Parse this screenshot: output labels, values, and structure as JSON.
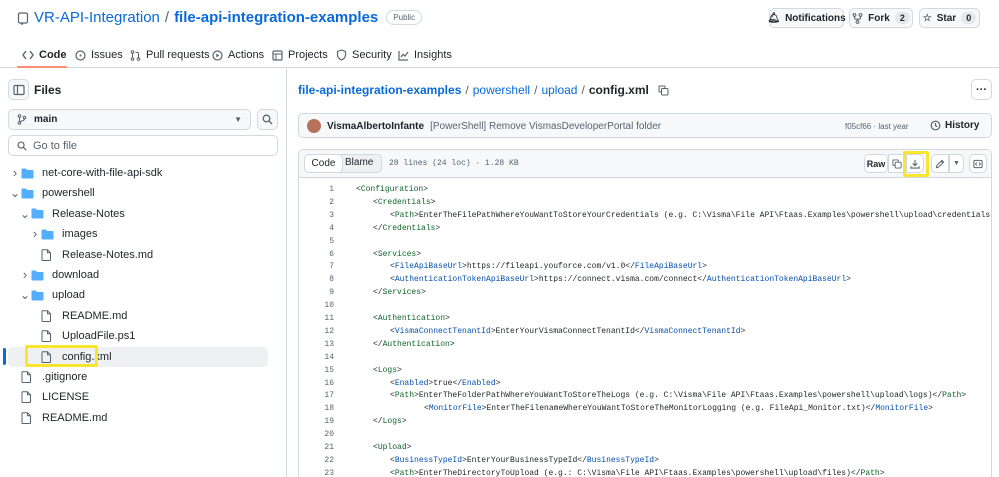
{
  "repo": {
    "owner": "VR-API-Integration",
    "separator": "/",
    "name": "file-api-integration-examples",
    "visibility": "Public"
  },
  "header_actions": {
    "notifications": "Notifications",
    "fork": "Fork",
    "fork_count": "2",
    "star": "Star",
    "star_count": "0"
  },
  "tabs": [
    "Code",
    "Issues",
    "Pull requests",
    "Actions",
    "Projects",
    "Security",
    "Insights"
  ],
  "sidebar": {
    "title": "Files",
    "branch": "main",
    "search_placeholder": "Go to file",
    "tree": [
      {
        "label": "net-core-with-file-api-sdk",
        "type": "folder",
        "open": false,
        "depth": 0
      },
      {
        "label": "powershell",
        "type": "folder",
        "open": true,
        "depth": 0
      },
      {
        "label": "Release-Notes",
        "type": "folder",
        "open": true,
        "depth": 1
      },
      {
        "label": "images",
        "type": "folder",
        "open": false,
        "depth": 2
      },
      {
        "label": "Release-Notes.md",
        "type": "file",
        "depth": 2
      },
      {
        "label": "download",
        "type": "folder",
        "open": false,
        "depth": 1
      },
      {
        "label": "upload",
        "type": "folder",
        "open": true,
        "depth": 1
      },
      {
        "label": "README.md",
        "type": "file",
        "depth": 2
      },
      {
        "label": "UploadFile.ps1",
        "type": "file",
        "depth": 2
      },
      {
        "label": "config.xml",
        "type": "file",
        "depth": 2,
        "selected": true
      },
      {
        "label": ".gitignore",
        "type": "file",
        "depth": 0
      },
      {
        "label": "LICENSE",
        "type": "file",
        "depth": 0
      },
      {
        "label": "README.md",
        "type": "file",
        "depth": 0
      }
    ]
  },
  "breadcrumb": {
    "parts": [
      "file-api-integration-examples",
      "powershell",
      "upload"
    ],
    "current": "config.xml",
    "sep": "/"
  },
  "commit": {
    "author": "VismaAlbertoInfante",
    "message": "[PowerShell] Remove VismasDeveloperPortal folder",
    "hash": "f05cf66 · last year",
    "history": "History"
  },
  "file_toolbar": {
    "code_tab": "Code",
    "blame_tab": "Blame",
    "info": "28 lines (24 loc) · 1.28 KB",
    "raw": "Raw"
  },
  "code_lines": [
    {
      "n": "1",
      "indent": 0,
      "text": "<Configuration>"
    },
    {
      "n": "2",
      "indent": 1,
      "text": "<Credentials>"
    },
    {
      "n": "3",
      "indent": 2,
      "text": "<Path>EnterTheFilePathWhereYouWantToStoreYourCredentials (e.g. C:\\Visma\\File API\\Ftaas.Examples\\powershell\\upload\\credentials\\credentials_integ"
    },
    {
      "n": "4",
      "indent": 1,
      "text": "</Credentials>"
    },
    {
      "n": "5",
      "indent": 0,
      "text": ""
    },
    {
      "n": "6",
      "indent": 1,
      "text": "<Services>"
    },
    {
      "n": "7",
      "indent": 2,
      "text": "<FileApiBaseUrl>https://fileapi.youforce.com/v1.0</FileApiBaseUrl>"
    },
    {
      "n": "8",
      "indent": 2,
      "text": "<AuthenticationTokenApiBaseUrl>https://connect.visma.com/connect</AuthenticationTokenApiBaseUrl>"
    },
    {
      "n": "9",
      "indent": 1,
      "text": "</Services>"
    },
    {
      "n": "10",
      "indent": 0,
      "text": ""
    },
    {
      "n": "11",
      "indent": 1,
      "text": "<Authentication>"
    },
    {
      "n": "12",
      "indent": 2,
      "text": "<VismaConnectTenantId>EnterYourVismaConnectTenantId</VismaConnectTenantId>"
    },
    {
      "n": "13",
      "indent": 1,
      "text": "</Authentication>"
    },
    {
      "n": "14",
      "indent": 0,
      "text": ""
    },
    {
      "n": "15",
      "indent": 1,
      "text": "<Logs>"
    },
    {
      "n": "16",
      "indent": 2,
      "text": "<Enabled>true</Enabled>"
    },
    {
      "n": "17",
      "indent": 2,
      "text": "<Path>EnterTheFolderPathWhereYouWantToStoreTheLogs (e.g. C:\\Visma\\File API\\Ftaas.Examples\\powershell\\upload\\logs)</Path>"
    },
    {
      "n": "18",
      "indent": 4,
      "text": "<MonitorFile>EnterTheFilenameWhereYouWantToStoreTheMonitorLogging (e.g. FileApi_Monitor.txt)</MonitorFile>"
    },
    {
      "n": "19",
      "indent": 1,
      "text": "</Logs>"
    },
    {
      "n": "20",
      "indent": 0,
      "text": ""
    },
    {
      "n": "21",
      "indent": 1,
      "text": "<Upload>"
    },
    {
      "n": "22",
      "indent": 2,
      "text": "<BusinessTypeId>EnterYourBusinessTypeId</BusinessTypeId>"
    },
    {
      "n": "23",
      "indent": 2,
      "text": "<Path>EnterTheDirectoryToUpload (e.g.: C:\\Visma\\File API\\Ftaas.Examples\\powershell\\upload\\files)</Path>"
    }
  ],
  "icons": {
    "repo": "repo-icon",
    "code": "code-icon",
    "issues": "issue-icon",
    "pulls": "pull-request-icon",
    "actions": "play-icon",
    "projects": "table-icon",
    "security": "shield-icon",
    "insights": "graph-icon"
  }
}
